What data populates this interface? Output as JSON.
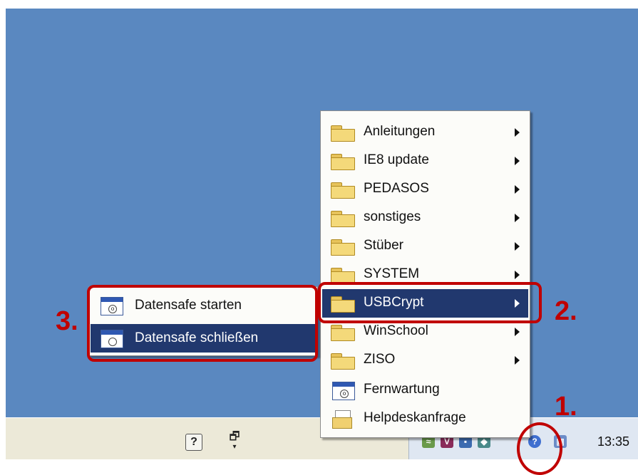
{
  "main_menu": {
    "items": [
      {
        "label": "Anleitungen",
        "icon": "folder-icon",
        "submenu": true
      },
      {
        "label": "IE8 update",
        "icon": "folder-icon",
        "submenu": true
      },
      {
        "label": "PEDASOS",
        "icon": "folder-icon",
        "submenu": true
      },
      {
        "label": "sonstiges",
        "icon": "folder-icon",
        "submenu": true
      },
      {
        "label": "Stüber",
        "icon": "folder-icon",
        "submenu": true
      },
      {
        "label": "SYSTEM",
        "icon": "folder-icon",
        "submenu": true
      },
      {
        "label": "USBCrypt",
        "icon": "folder-icon",
        "submenu": true,
        "selected": true
      },
      {
        "label": "WinSchool",
        "icon": "folder-icon",
        "submenu": true
      },
      {
        "label": "ZISO",
        "icon": "folder-icon",
        "submenu": true
      },
      {
        "label": "Fernwartung",
        "icon": "app-window-icon",
        "submenu": false
      },
      {
        "label": "Helpdeskanfrage",
        "icon": "help-request-icon",
        "submenu": false
      }
    ]
  },
  "sub_menu": {
    "items": [
      {
        "label": "Datensafe starten",
        "icon": "app-window-icon"
      },
      {
        "label": "Datensafe schließen",
        "icon": "app-window-icon",
        "selected": true
      }
    ]
  },
  "taskbar": {
    "clock": "13:35",
    "help_glyph": "?",
    "restore_glyph": "🗗"
  },
  "annotations": {
    "step1": "1.",
    "step2": "2.",
    "step3": "3."
  },
  "colors": {
    "desktop": "#5a88c0",
    "highlight": "#21386e",
    "annotation": "#c00000",
    "taskbar": "#ece9d8"
  }
}
